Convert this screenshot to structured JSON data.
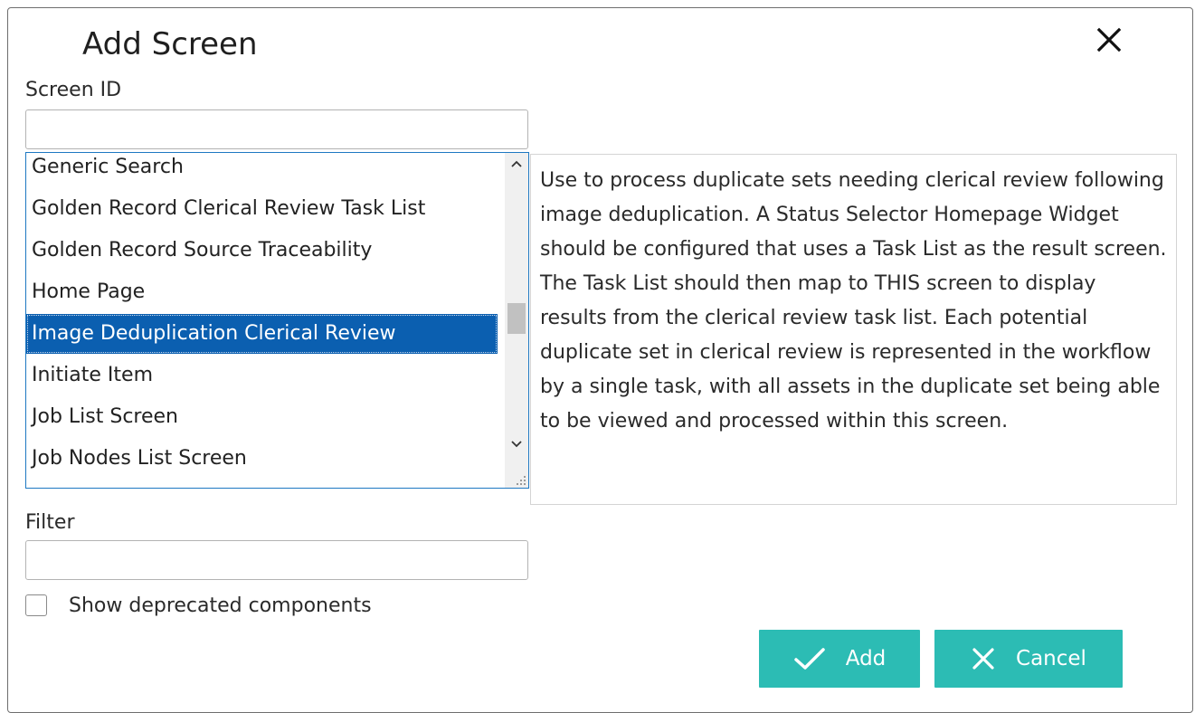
{
  "dialog": {
    "title": "Add Screen"
  },
  "screen_id": {
    "label": "Screen ID",
    "value": "",
    "placeholder": ""
  },
  "screen_list": {
    "items": [
      {
        "label": "Generic Search",
        "selected": false
      },
      {
        "label": "Golden Record Clerical Review Task List",
        "selected": false
      },
      {
        "label": "Golden Record Source Traceability",
        "selected": false
      },
      {
        "label": "Home Page",
        "selected": false
      },
      {
        "label": "Image Deduplication Clerical Review",
        "selected": true
      },
      {
        "label": "Initiate Item",
        "selected": false
      },
      {
        "label": "Job List Screen",
        "selected": false
      },
      {
        "label": "Job Nodes List Screen",
        "selected": false
      }
    ]
  },
  "description": "Use to process duplicate sets needing clerical review following image deduplication. A Status Selector Homepage Widget should be configured that uses a Task List as the result screen. The Task List should then map to THIS screen to display results from the clerical review task list. Each potential duplicate set in clerical review is represented in the workflow by a single task, with all assets in the duplicate set being able to be viewed and processed within this screen.",
  "filter": {
    "label": "Filter",
    "value": "",
    "placeholder": ""
  },
  "show_deprecated": {
    "label": "Show deprecated components",
    "checked": false
  },
  "buttons": {
    "add_label": "Add",
    "cancel_label": "Cancel"
  },
  "icons": {
    "close": "close-icon",
    "add": "check-icon",
    "cancel": "x-icon",
    "scroll_up": "chevron-up-icon",
    "scroll_down": "chevron-down-icon",
    "resize": "resize-grip-icon"
  },
  "colors": {
    "accent": "#2cbcb4",
    "selection": "#0b5fb0",
    "focus_border": "#1e78c2"
  }
}
